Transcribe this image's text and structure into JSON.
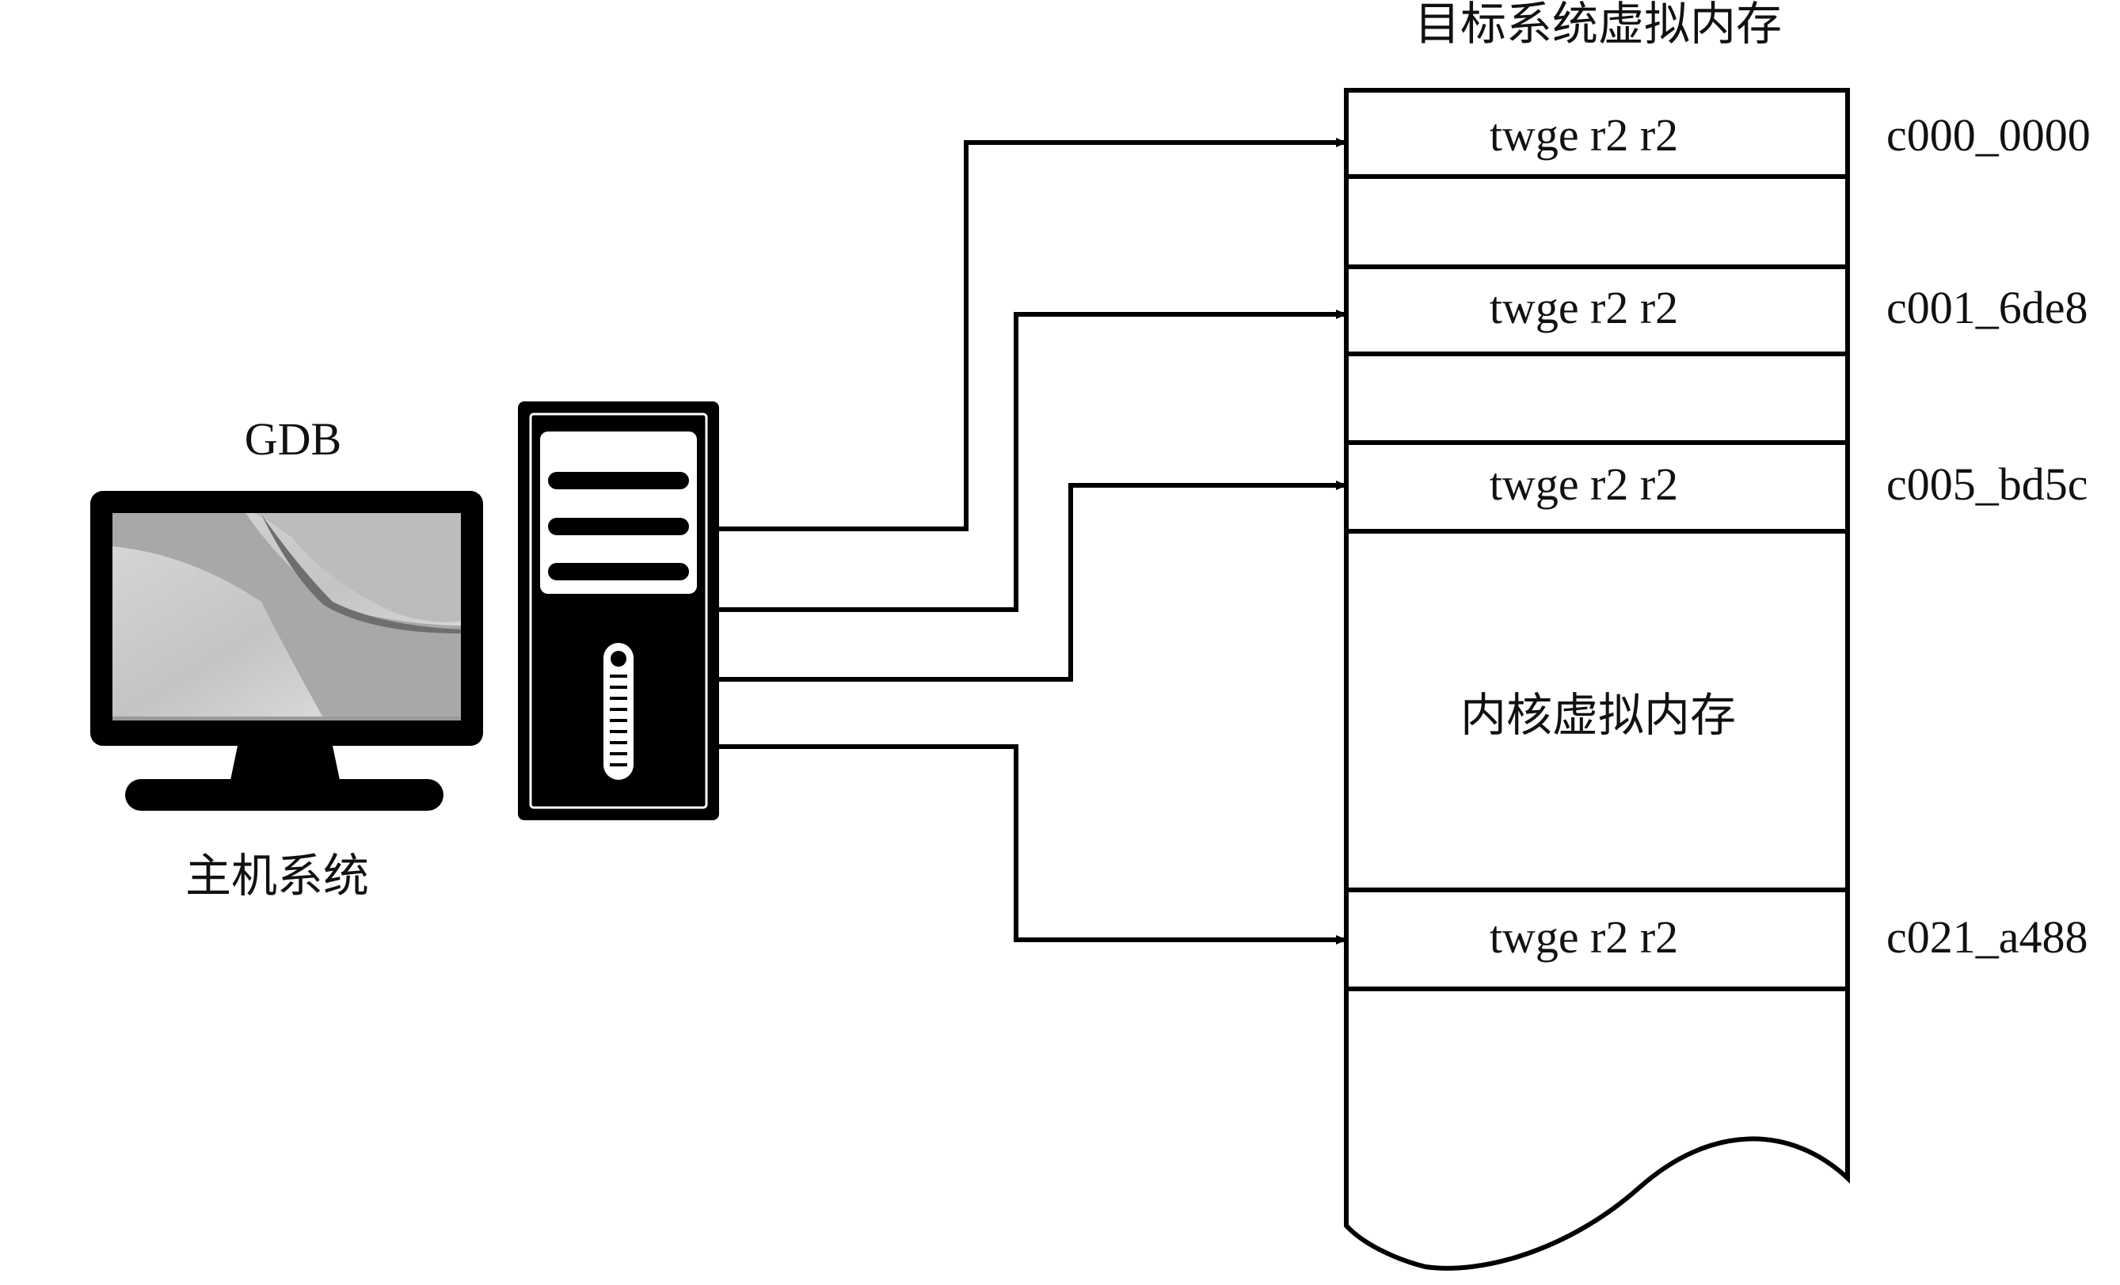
{
  "host": {
    "gdb_label": "GDB",
    "host_label": "主机系统"
  },
  "memory": {
    "title": "目标系统虚拟内存",
    "region_label": "内核虚拟内存",
    "entries": [
      {
        "instruction": "twge r2 r2",
        "address": "c000_0000"
      },
      {
        "instruction": "twge r2 r2",
        "address": "c001_6de8"
      },
      {
        "instruction": "twge r2 r2",
        "address": "c005_bd5c"
      },
      {
        "instruction": "twge r2 r2",
        "address": "c021_a488"
      }
    ]
  },
  "icons": {
    "monitor": "monitor-icon",
    "tower": "computer-tower-icon"
  }
}
